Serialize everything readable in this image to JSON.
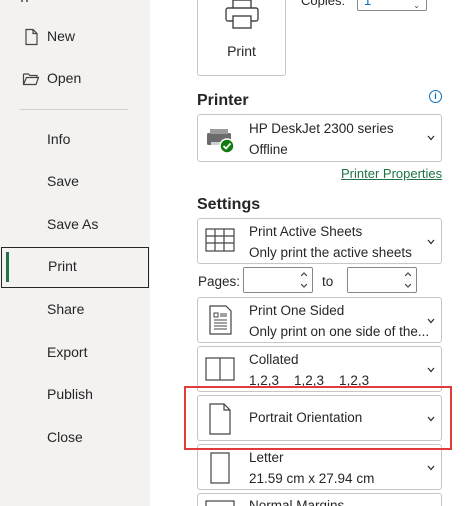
{
  "nav": {
    "items": [
      {
        "label": "New"
      },
      {
        "label": "Open"
      },
      {
        "label": "Info"
      },
      {
        "label": "Save"
      },
      {
        "label": "Save As"
      },
      {
        "label": "Print"
      },
      {
        "label": "Share"
      },
      {
        "label": "Export"
      },
      {
        "label": "Publish"
      },
      {
        "label": "Close"
      }
    ],
    "selected": "Print"
  },
  "print_button": {
    "label": "Print"
  },
  "copies": {
    "label": "Copies:",
    "value": "1"
  },
  "printer": {
    "section_title": "Printer",
    "name": "HP DeskJet 2300 series",
    "status": "Offline",
    "properties_link": "Printer Properties"
  },
  "settings": {
    "section_title": "Settings",
    "scope": {
      "title": "Print Active Sheets",
      "subtitle": "Only print the active sheets"
    },
    "pages": {
      "label": "Pages:",
      "to_label": "to",
      "from_value": "",
      "to_value": ""
    },
    "sides": {
      "title": "Print One Sided",
      "subtitle": "Only print on one side of the..."
    },
    "collation": {
      "title": "Collated",
      "subtitle": "1,2,3    1,2,3    1,2,3"
    },
    "orientation": {
      "title": "Portrait Orientation"
    },
    "paper": {
      "title": "Letter",
      "subtitle": "21.59 cm x 27.94 cm"
    },
    "margins": {
      "title": "Normal Margins"
    }
  },
  "colors": {
    "accent": "#217346",
    "highlight": "#e03c3c",
    "link": "#217346"
  }
}
